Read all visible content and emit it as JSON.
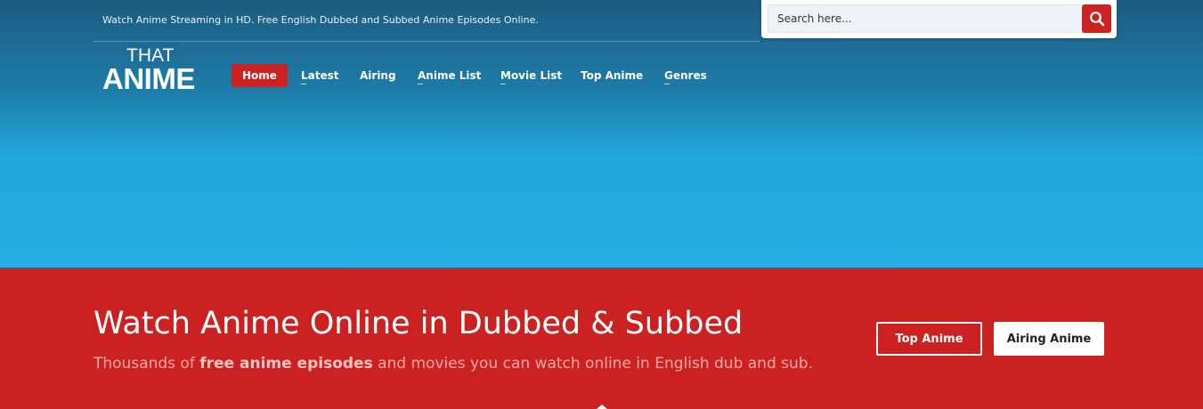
{
  "header": {
    "tagline": "Watch Anime Streaming in HD. Free English Dubbed and Subbed Anime Episodes Online.",
    "logo": {
      "line1": "THAT",
      "line2": "ANIME"
    },
    "search": {
      "placeholder": "Search here...",
      "icon": "search-icon"
    },
    "nav": [
      {
        "label": "Home",
        "active": true
      },
      {
        "label": "Latest"
      },
      {
        "label": "Airing"
      },
      {
        "label": "Anime List"
      },
      {
        "label": "Movie List"
      },
      {
        "label": "Top Anime"
      },
      {
        "label": "Genres"
      }
    ]
  },
  "hero": {
    "title": "Watch Anime Online in Dubbed & Subbed",
    "subtitle_before": "Thousands of ",
    "subtitle_bold": "free anime episodes",
    "subtitle_after": " and movies you can watch online in English dub and sub.",
    "buttons": {
      "top_anime": "Top Anime",
      "airing_anime": "Airing Anime"
    }
  },
  "colors": {
    "accent_red": "#cc2222",
    "header_blue_top": "#1c5c80",
    "header_blue_bottom": "#25aee3"
  }
}
